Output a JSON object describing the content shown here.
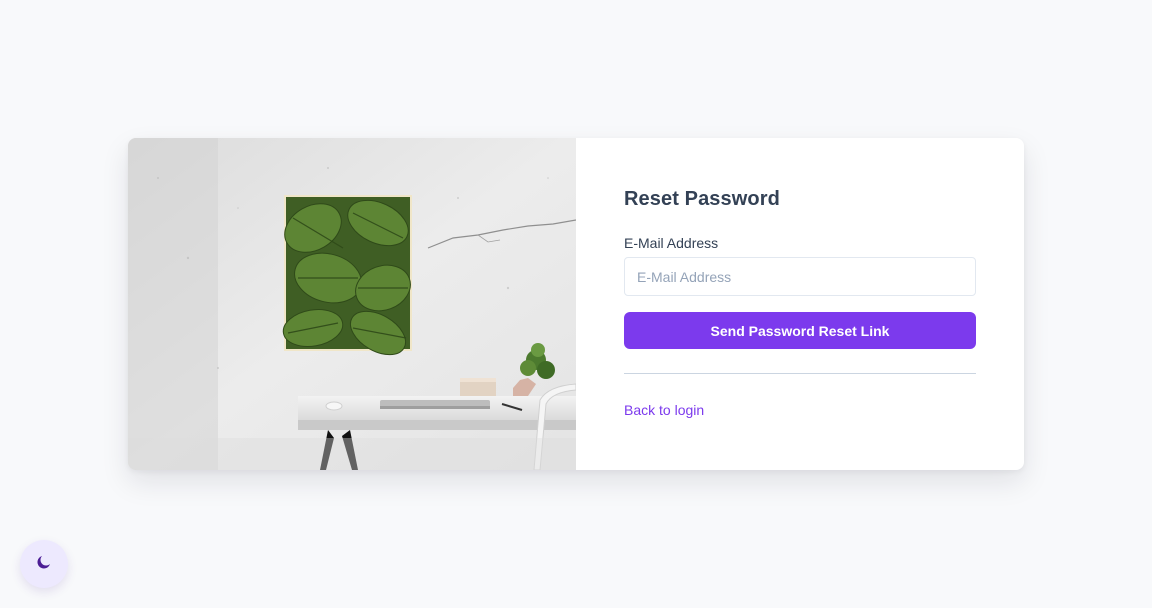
{
  "form": {
    "title": "Reset Password",
    "email_label": "E-Mail Address",
    "email_placeholder": "E-Mail Address",
    "email_value": "",
    "submit_label": "Send Password Reset Link",
    "back_link_label": "Back to login"
  },
  "theme_toggle": {
    "icon": "moon-icon"
  },
  "colors": {
    "accent": "#7c3aed",
    "page_background": "#f8f9fb",
    "card_background": "#ffffff",
    "text": "#334155",
    "toggle_background": "#ede9fe"
  }
}
